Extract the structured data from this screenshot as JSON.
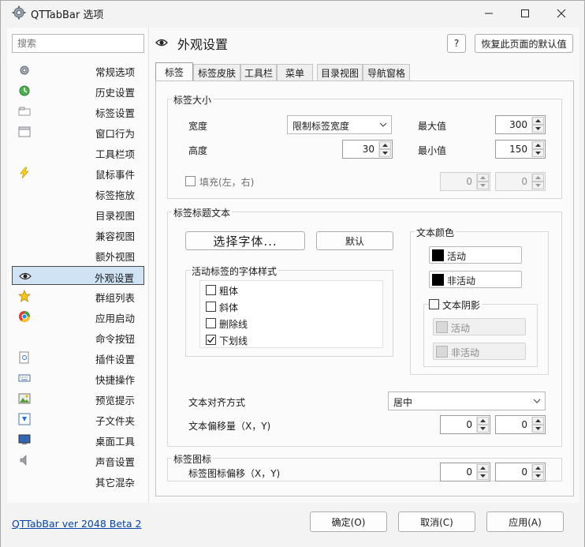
{
  "window": {
    "title": "QTTabBar 选项"
  },
  "sidebar": {
    "search_placeholder": "搜索",
    "items": [
      {
        "label": "常规选项",
        "icon": "gear-icon"
      },
      {
        "label": "历史设置",
        "icon": "history-icon"
      },
      {
        "label": "标签设置",
        "icon": "tab-icon"
      },
      {
        "label": "窗口行为",
        "icon": "window-icon"
      },
      {
        "label": "工具栏项",
        "icon": ""
      },
      {
        "label": "鼠标事件",
        "icon": "lightning-icon"
      },
      {
        "label": "标签拖放",
        "icon": ""
      },
      {
        "label": "目录视图",
        "icon": ""
      },
      {
        "label": "兼容视图",
        "icon": ""
      },
      {
        "label": "额外视图",
        "icon": ""
      },
      {
        "label": "外观设置",
        "icon": "eye-icon"
      },
      {
        "label": "群组列表",
        "icon": "star-icon"
      },
      {
        "label": "应用启动",
        "icon": "app-launch-icon"
      },
      {
        "label": "命令按钮",
        "icon": ""
      },
      {
        "label": "插件设置",
        "icon": "plugin-icon"
      },
      {
        "label": "快捷操作",
        "icon": "keyboard-icon"
      },
      {
        "label": "预览提示",
        "icon": "preview-icon"
      },
      {
        "label": "子文件夹",
        "icon": "subfolder-icon"
      },
      {
        "label": "桌面工具",
        "icon": "desktop-icon"
      },
      {
        "label": "声音设置",
        "icon": "speaker-icon"
      },
      {
        "label": "其它混杂",
        "icon": ""
      }
    ],
    "active_index": 10
  },
  "header": {
    "title": "外观设置",
    "help": "?",
    "restore_label": "恢复此页面的默认值"
  },
  "tabs": [
    "标签",
    "标签皮肤",
    "工具栏",
    "菜单",
    "目录视图",
    "导航窗格"
  ],
  "size_group": {
    "label": "标签大小",
    "width_label": "宽度",
    "width_mode": "限制标签宽度",
    "height_label": "高度",
    "height_value": "30",
    "max_label": "最大值",
    "max_value": "300",
    "min_label": "最小值",
    "min_value": "150",
    "padding_label": "填充(左，右)",
    "padding_left": "0",
    "padding_right": "0"
  },
  "title_group": {
    "label": "标签标题文本",
    "font_button": "选择字体...",
    "default_button": "默认",
    "font_style_label": "活动标签的字体样式",
    "styles": [
      {
        "label": "粗体",
        "checked": false
      },
      {
        "label": "斜体",
        "checked": false
      },
      {
        "label": "删除线",
        "checked": false
      },
      {
        "label": "下划线",
        "checked": true
      }
    ],
    "color_label": "文本颜色",
    "active_color": "活动",
    "inactive_color": "非活动",
    "shadow_label": "文本阴影",
    "shadow_active": "活动",
    "shadow_inactive": "非活动",
    "align_label": "文本对齐方式",
    "align_value": "居中",
    "offset_label": "文本偏移量（X，Y)",
    "offset_x": "0",
    "offset_y": "0"
  },
  "icon_group": {
    "label": "标签图标",
    "offset_label": "标签图标偏移（X，Y)",
    "offset_x": "0",
    "offset_y": "0"
  },
  "footer": {
    "version": "QTTabBar ver 2048 Beta 2",
    "ok": "确定(O)",
    "cancel": "取消(C)",
    "apply": "应用(A)"
  },
  "colors": {
    "active_nav_bg": "#cfe3f5",
    "link": "#0645ad"
  }
}
